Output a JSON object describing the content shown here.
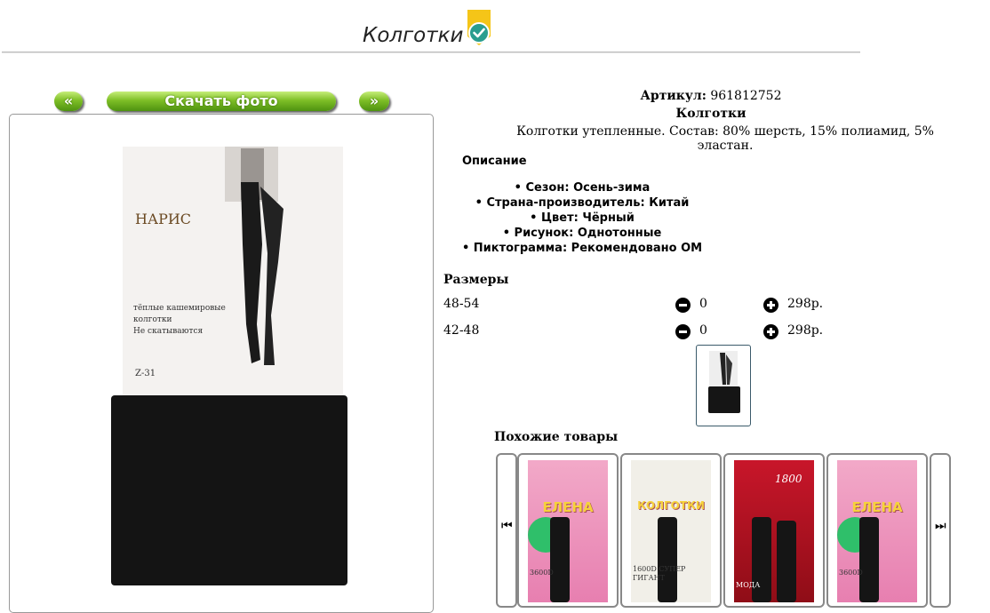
{
  "page": {
    "title": "Колготки"
  },
  "gallery": {
    "prev_label": "«",
    "download_label": "Скачать фото",
    "next_label": "»",
    "photo_alt": "Колготки"
  },
  "packaging": {
    "brand": "НАРИС",
    "text_line1": "тёплые кашемировые",
    "text_line2": "колготки",
    "text_line3": "Не скатываются",
    "code": "Z-31"
  },
  "product": {
    "sku_label": "Артикул:",
    "sku_value": "961812752",
    "name": "Колготки",
    "description": "Колготки утепленные. Состав: 80% шерсть, 15% полиамид, 5% эластан.",
    "description_heading": "Описание",
    "features": [
      "Сезон: Осень-зима",
      "Страна-производитель: Китай",
      "Цвет: Чёрный",
      "Рисунок: Однотонные",
      "Пиктограмма: Рекомендовано ОМ"
    ]
  },
  "sizes": {
    "heading": "Размеры",
    "rows": [
      {
        "size": "48-54",
        "qty": "0",
        "price": "298р."
      },
      {
        "size": "42-48",
        "qty": "0",
        "price": "298р."
      }
    ]
  },
  "similar": {
    "heading": "Похожие товары",
    "prev_icon": "⏮",
    "next_icon": "⏭",
    "items": [
      {
        "word": "ЕЛЕНА",
        "sub": "3600D"
      },
      {
        "word": "КОЛГОТКИ",
        "sub": "1600D СУПЕР ГИГАНТ"
      },
      {
        "word": "1800",
        "sub": "МОДА"
      },
      {
        "word": "ЕЛЕНА",
        "sub": "3600D"
      }
    ]
  },
  "colors": {
    "accent_green": "#7fbf27",
    "badge_yellow": "#f5c518",
    "badge_teal": "#2a9d8f"
  }
}
